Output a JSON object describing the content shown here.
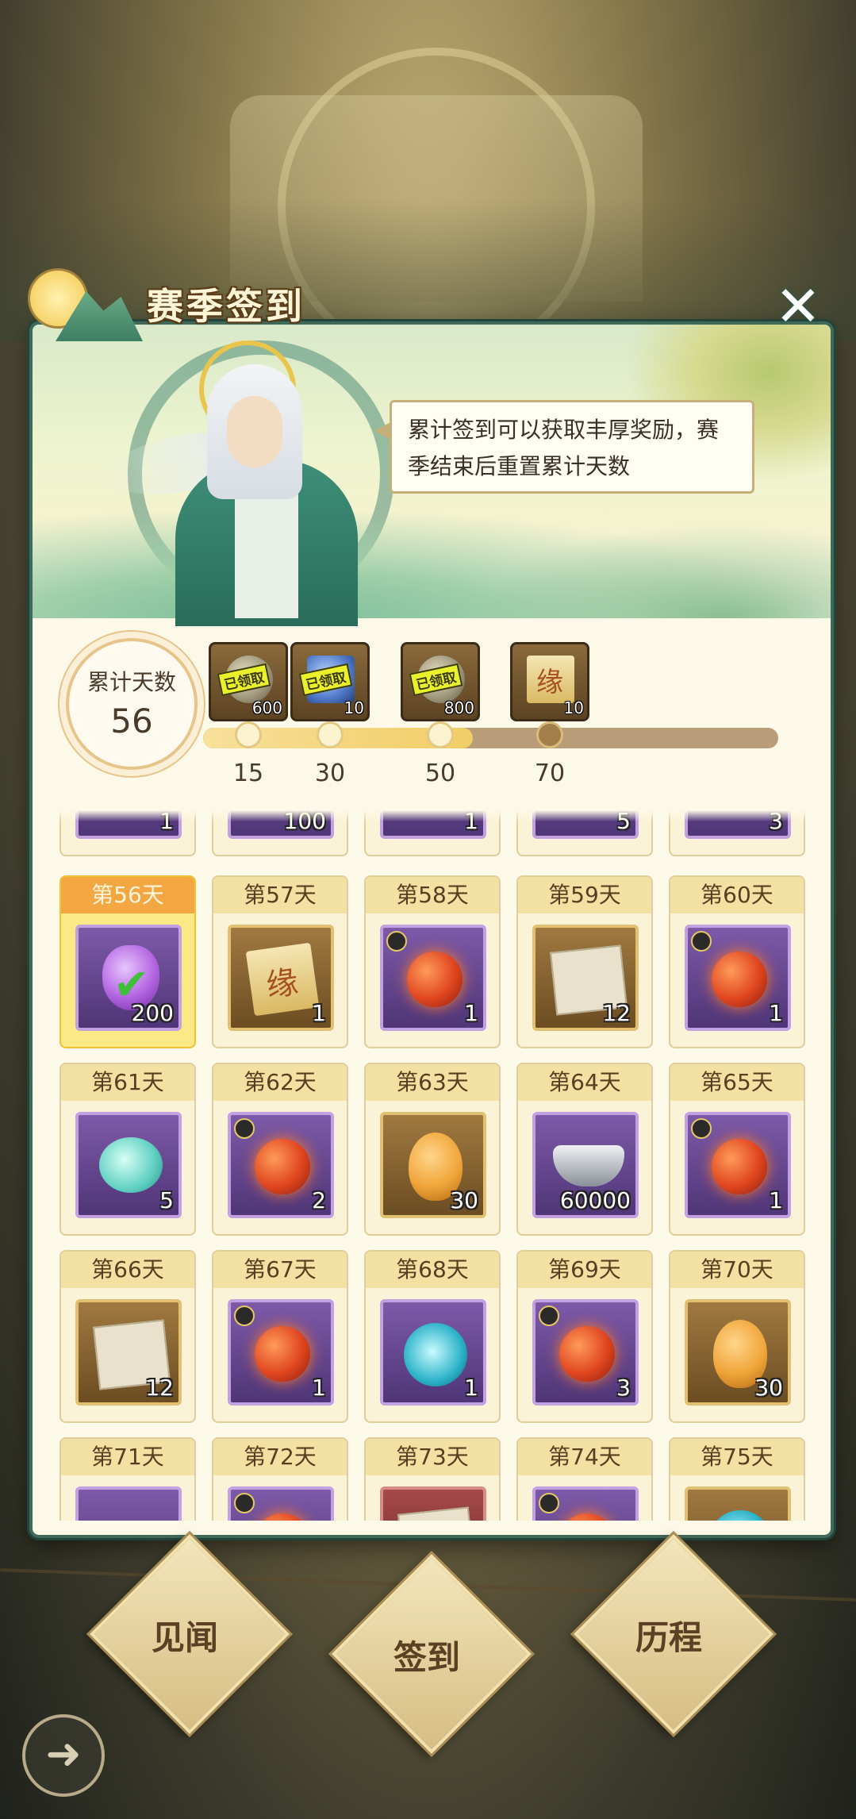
{
  "header": {
    "title": "赛季签到"
  },
  "speech": "累计签到可以获取丰厚奖励，赛季结束后重置累计天数",
  "cumulative": {
    "label": "累计天数",
    "days": 56
  },
  "progress": {
    "max": 70,
    "current": 56,
    "milestones": [
      {
        "day": "15",
        "count": "600",
        "claimed": "已领取"
      },
      {
        "day": "30",
        "count": "10",
        "claimed": "已领取"
      },
      {
        "day": "50",
        "count": "800",
        "claimed": "已领取"
      },
      {
        "day": "70",
        "count": "10",
        "claimed": ""
      }
    ]
  },
  "prev_row_counts": [
    "1",
    "100",
    "1",
    "5",
    "3"
  ],
  "days": [
    {
      "label": "第56天",
      "count": "200",
      "icon": "stone-checked",
      "frame": "purple",
      "today": true
    },
    {
      "label": "第57天",
      "count": "1",
      "icon": "fate-scroll",
      "frame": "gold"
    },
    {
      "label": "第58天",
      "count": "1",
      "icon": "fire-orb",
      "frame": "purple",
      "timed": true
    },
    {
      "label": "第59天",
      "count": "12",
      "icon": "papers",
      "frame": "gold"
    },
    {
      "label": "第60天",
      "count": "1",
      "icon": "fire-orb",
      "frame": "purple",
      "timed": true
    },
    {
      "label": "第61天",
      "count": "5",
      "icon": "jade-egg",
      "frame": "purple"
    },
    {
      "label": "第62天",
      "count": "2",
      "icon": "fire-orb",
      "frame": "purple",
      "timed": true
    },
    {
      "label": "第63天",
      "count": "30",
      "icon": "amber-egg",
      "frame": "gold"
    },
    {
      "label": "第64天",
      "count": "60000",
      "icon": "silver-ingot",
      "frame": "purple"
    },
    {
      "label": "第65天",
      "count": "1",
      "icon": "fire-orb",
      "frame": "purple",
      "timed": true
    },
    {
      "label": "第66天",
      "count": "12",
      "icon": "papers",
      "frame": "gold"
    },
    {
      "label": "第67天",
      "count": "1",
      "icon": "fire-orb",
      "frame": "purple",
      "timed": true
    },
    {
      "label": "第68天",
      "count": "1",
      "icon": "rune-stone",
      "frame": "purple"
    },
    {
      "label": "第69天",
      "count": "3",
      "icon": "fire-orb",
      "frame": "purple",
      "timed": true
    },
    {
      "label": "第70天",
      "count": "30",
      "icon": "amber-egg",
      "frame": "gold"
    },
    {
      "label": "第71天",
      "count": "",
      "icon": "unknown",
      "frame": "purple"
    },
    {
      "label": "第72天",
      "count": "",
      "icon": "fire-orb",
      "frame": "purple",
      "timed": true
    },
    {
      "label": "第73天",
      "count": "",
      "icon": "papers",
      "frame": "red"
    },
    {
      "label": "第74天",
      "count": "",
      "icon": "fire-orb",
      "frame": "purple",
      "timed": true
    },
    {
      "label": "第75天",
      "count": "",
      "icon": "rune-stone",
      "frame": "gold"
    }
  ],
  "bottom_nav": [
    {
      "label": "见闻"
    },
    {
      "label": "签到"
    },
    {
      "label": "历程"
    }
  ],
  "fate_char": "缘",
  "close_icon": "close-icon",
  "back_icon": "back-arrow-icon"
}
